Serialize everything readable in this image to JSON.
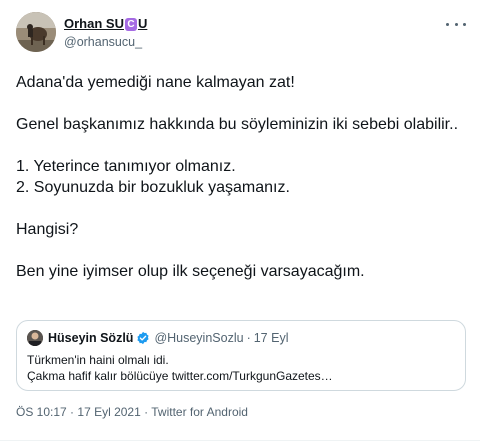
{
  "author": {
    "display_name": "Orhan SU",
    "name_badge": "C",
    "name_suffix": "U",
    "handle": "@orhansucu_"
  },
  "icons": {
    "more": "more-horizontal-icon",
    "verified": "verified-badge-icon"
  },
  "tweet": {
    "lines": [
      "Adana'da yemediği nane kalmayan zat!",
      "",
      "Genel başkanımız hakkında bu söyleminizin iki sebebi olabilir..",
      "",
      "1. Yeterince tanımıyor olmanız.",
      "2. Soyunuzda bir bozukluk yaşamanız.",
      "",
      "Hangisi?",
      "",
      "Ben yine iyimser olup ilk seçeneği varsayacağım."
    ]
  },
  "quote": {
    "name": "Hüseyin Sözlü",
    "handle": "@HuseyinSozlu",
    "separator": "·",
    "date": "17 Eyl",
    "line1": "Türkmen'in haini olmalı idi.",
    "line2": "Çakma hafif kalır bölücüye twitter.com/TurkgunGazetes…"
  },
  "meta": {
    "time": "ÖS 10:17",
    "separator": "·",
    "date": "17 Eyl 2021",
    "source": "Twitter for Android"
  },
  "colors": {
    "text": "#0f1419",
    "secondary": "#536471",
    "verified": "#1d9bf0",
    "border": "#cfd9de",
    "badge": "#a56be3"
  }
}
